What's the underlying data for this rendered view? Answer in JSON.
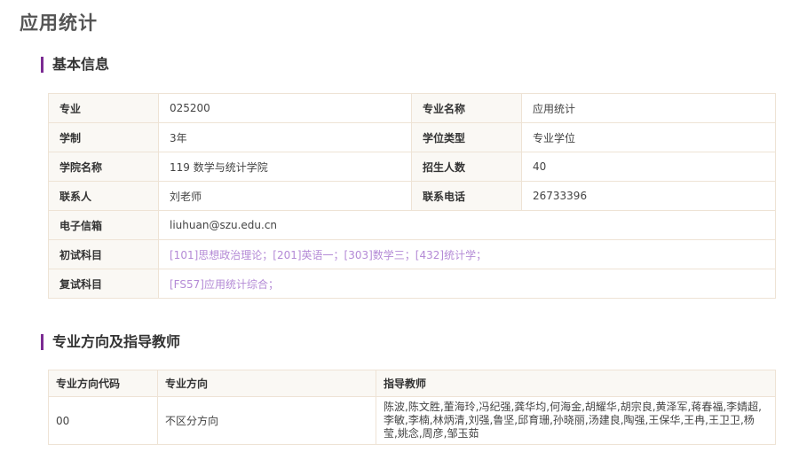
{
  "page_title": "应用统计",
  "basic_section": {
    "title": "基本信息",
    "rows": [
      [
        {
          "label": "专业",
          "value": "025200"
        },
        {
          "label": "专业名称",
          "value": "应用统计"
        }
      ],
      [
        {
          "label": "学制",
          "value": "3年"
        },
        {
          "label": "学位类型",
          "value": "专业学位"
        }
      ],
      [
        {
          "label": "学院名称",
          "value": "119 数学与统计学院"
        },
        {
          "label": "招生人数",
          "value": "40"
        }
      ],
      [
        {
          "label": "联系人",
          "value": "刘老师"
        },
        {
          "label": "联系电话",
          "value": "26733396"
        }
      ]
    ],
    "email": {
      "label": "电子信箱",
      "value": "liuhuan@szu.edu.cn"
    },
    "initial_exam": {
      "label": "初试科目",
      "value": "[101]思想政治理论；[201]英语一；[303]数学三；[432]统计学；"
    },
    "retest_exam": {
      "label": "复试科目",
      "value": "[FS57]应用统计综合；"
    }
  },
  "direction_section": {
    "title": "专业方向及指导教师",
    "headers": [
      "专业方向代码",
      "专业方向",
      "指导教师"
    ],
    "rows": [
      {
        "code": "00",
        "direction": "不区分方向",
        "teachers": "陈波,陈文胜,董海玲,冯纪强,龚华均,何海金,胡耀华,胡宗良,黄泽军,蒋春福,李婧超,李敏,李楠,林炳清,刘强,鲁坚,邱育珊,孙晓丽,汤建良,陶强,王保华,王冉,王卫卫,杨莹,姚念,周彦,邹玉茹"
      }
    ]
  },
  "colors": {
    "accent": "#7b2b93",
    "link": "#b48ad6",
    "border": "#eee3d5",
    "label_bg": "#faf8f4"
  }
}
